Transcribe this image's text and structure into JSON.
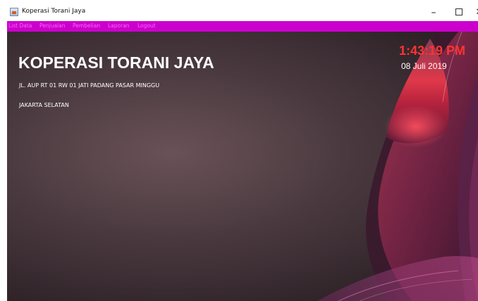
{
  "window": {
    "title": "Koperasi Torani Jaya",
    "controls": {
      "minimize": "–",
      "close": "✕"
    }
  },
  "menu": {
    "items": [
      "List Data",
      "Penjualan",
      "Pembelian",
      "Laporan",
      "Logout"
    ]
  },
  "company": {
    "name": "KOPERASI TORANI JAYA",
    "address": "JL. AUP RT 01 RW 01 JATI PADANG PASAR MINGGU",
    "city": "JAKARTA SELATAN"
  },
  "clock": {
    "time": "1:43:19 PM",
    "date": "08 Juli 2019"
  },
  "colors": {
    "menubar": "#cc00cc",
    "menu_text": "#ff66ff",
    "clock_time": "#ff3333",
    "background": "#4a3a40"
  },
  "icons": {
    "app": "java-app-icon",
    "minimize": "minimize-icon",
    "maximize": "maximize-icon",
    "close": "close-icon"
  }
}
